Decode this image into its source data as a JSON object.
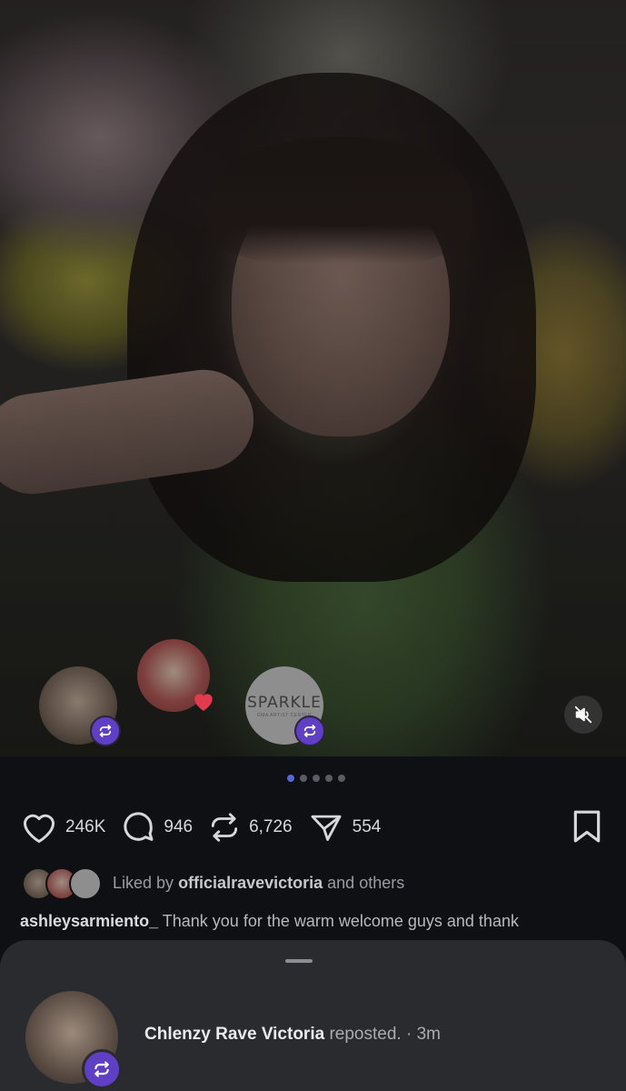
{
  "post": {
    "indicator": {
      "count": 5,
      "active_index": 0
    },
    "overlay": {
      "sparkle_brand": "SPARKLE",
      "sparkle_sub": "GMA ARTIST CENTER"
    },
    "stats": {
      "likes": "246K",
      "comments": "946",
      "reposts": "6,726",
      "shares": "554"
    },
    "liked_by": {
      "prefix": "Liked by",
      "user": "officialravevictoria",
      "suffix": "and others"
    },
    "caption": {
      "username": "ashleysarmiento_",
      "text": "Thank you for the warm welcome guys and thank"
    }
  },
  "sheet": {
    "user": "Chlenzy Rave Victoria",
    "action": "reposted.",
    "separator": "·",
    "time": "3m"
  },
  "colors": {
    "accent": "#5667d6",
    "repost_badge": "#5f3fc4",
    "heart": "#e23a4e"
  }
}
